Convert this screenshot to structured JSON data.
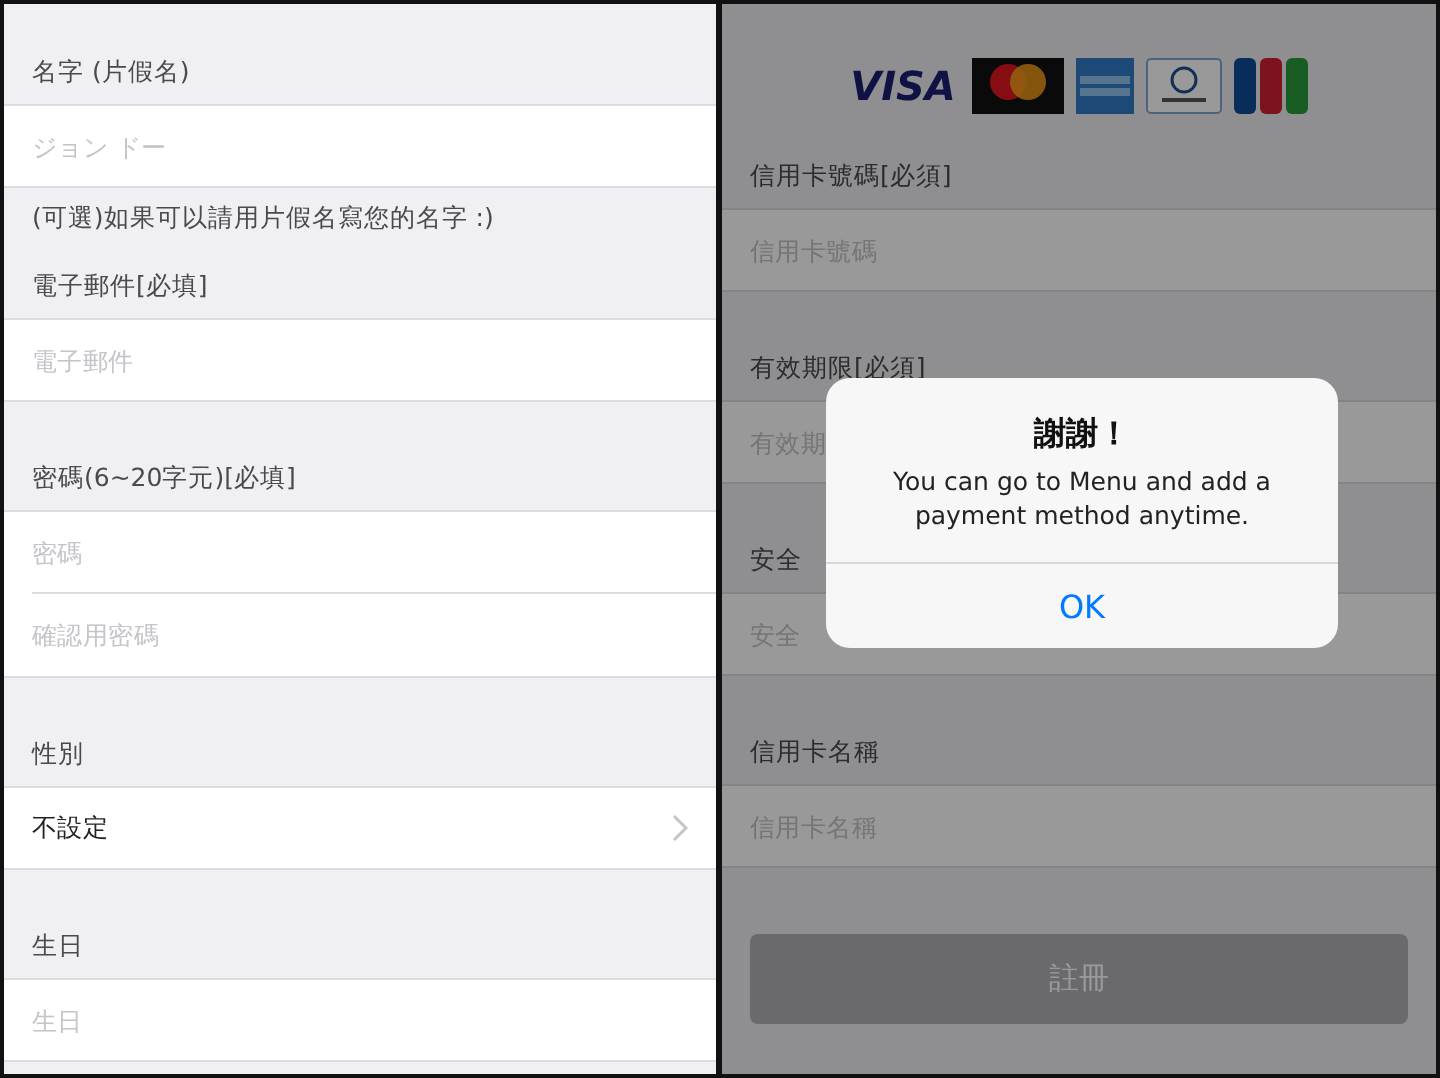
{
  "left_screen": {
    "rows": [
      {
        "kind": "section_header",
        "text": "名字 (片假名)"
      },
      {
        "kind": "field",
        "placeholder": "ジョン ドー"
      },
      {
        "kind": "note",
        "text": "(可選)如果可以請用片假名寫您的名字 :)"
      },
      {
        "kind": "header",
        "text": "電子郵件[必填]"
      },
      {
        "kind": "field",
        "placeholder": "電子郵件"
      },
      {
        "kind": "section_header",
        "text": "密碼(6~20字元)[必填]"
      },
      {
        "kind": "field",
        "placeholder": "密碼",
        "divider": true
      },
      {
        "kind": "field",
        "placeholder": "確認用密碼"
      },
      {
        "kind": "section_header",
        "text": "性別"
      },
      {
        "kind": "select",
        "value": "不設定"
      },
      {
        "kind": "section_header",
        "text": "生日"
      },
      {
        "kind": "field",
        "placeholder": "生日"
      }
    ]
  },
  "right_screen": {
    "dimmed": true,
    "card_brands": [
      {
        "kind": "visa",
        "label": "VISA"
      },
      {
        "kind": "mastercard"
      },
      {
        "kind": "amex"
      },
      {
        "kind": "diners"
      },
      {
        "kind": "jcb"
      }
    ],
    "rows": [
      {
        "kind": "header",
        "text": "信用卡號碼[必須]"
      },
      {
        "kind": "field",
        "placeholder": "信用卡號碼"
      },
      {
        "kind": "section_header",
        "text": "有效期限[必須]"
      },
      {
        "kind": "field",
        "placeholder": "有效期"
      },
      {
        "kind": "section_header",
        "text": "安全"
      },
      {
        "kind": "field",
        "placeholder": "安全"
      },
      {
        "kind": "section_header",
        "text": "信用卡名稱"
      },
      {
        "kind": "field",
        "placeholder": "信用卡名稱"
      }
    ],
    "submit_button": "註冊"
  },
  "alert": {
    "title": "謝謝！",
    "message": "You can go to Menu and add a payment method anytime.",
    "button": "OK"
  }
}
